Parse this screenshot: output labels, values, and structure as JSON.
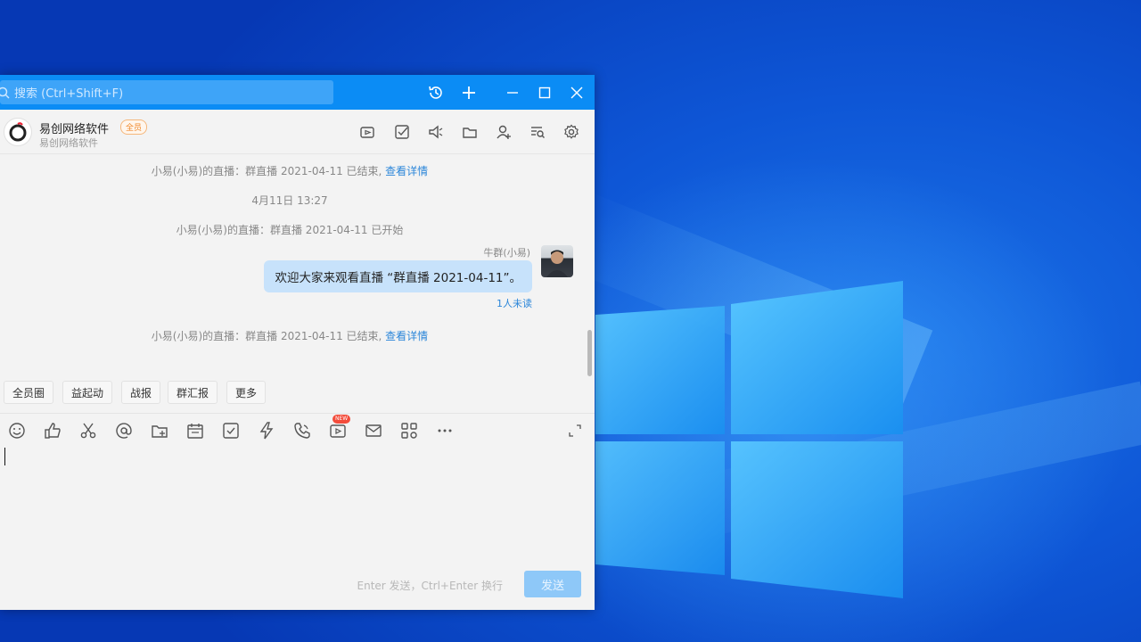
{
  "window": {
    "search": {
      "placeholder": "搜索 (Ctrl+Shift+F)"
    },
    "titlebar_buttons": [
      "history-icon",
      "add-icon",
      "minimize-icon",
      "maximize-icon",
      "close-icon"
    ]
  },
  "header": {
    "group_name": "易创网络软件",
    "badge": "全员",
    "subtitle": "易创网络软件",
    "icons": [
      "live-video-icon",
      "task-check-icon",
      "announcement-icon",
      "folder-icon",
      "add-member-icon",
      "chat-search-icon",
      "settings-icon"
    ]
  },
  "messages": {
    "sys1": {
      "text": "小易(小易)的直播：群直播 2021-04-11 已结束,",
      "link": "查看详情"
    },
    "timestamp": "4月11日 13:27",
    "sys2": {
      "text": "小易(小易)的直播：群直播 2021-04-11 已开始"
    },
    "chat": {
      "sender": "牛群(小易)",
      "text": "欢迎大家来观看直播 “群直播 2021-04-11”。",
      "status": "1人未读"
    },
    "sys3": {
      "text": "小易(小易)的直播：群直播 2021-04-11 已结束,",
      "link": "查看详情"
    }
  },
  "quick_actions": [
    "全员圈",
    "益起动",
    "战报",
    "群汇报",
    "更多"
  ],
  "toolbar": {
    "icons": [
      "emoji-icon",
      "thumbs-up-icon",
      "scissors-icon",
      "mention-icon",
      "folder-upload-icon",
      "calendar-icon",
      "task-icon",
      "lightning-icon",
      "phone-icon",
      "live-icon",
      "mail-icon",
      "apps-icon",
      "more-icon"
    ],
    "new_badge": "NEW"
  },
  "composer": {
    "hint": "Enter 发送，Ctrl+Enter 换行",
    "send_label": "发送"
  },
  "colors": {
    "titlebar": "#0b8cf5",
    "bubble": "#c7e2fb",
    "link": "#2b86d9",
    "send_button": "#8ec8f8"
  }
}
